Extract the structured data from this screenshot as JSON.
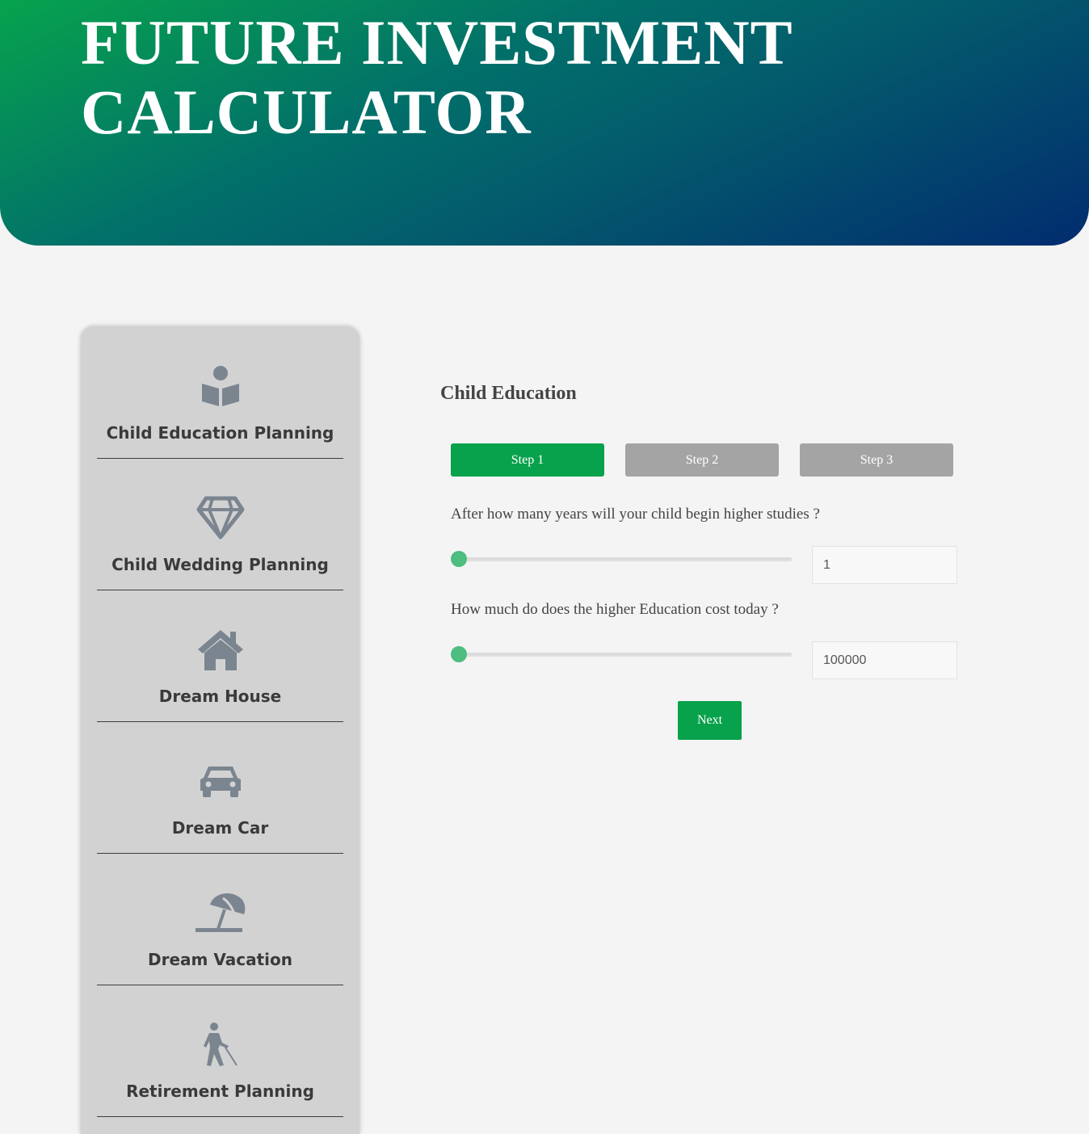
{
  "header": {
    "title_line1": "FUTURE INVESTMENT",
    "title_line2": "CALCULATOR"
  },
  "sidebar": {
    "items": [
      {
        "label": "Child Education Planning",
        "icon": "book-reader-icon"
      },
      {
        "label": "Child Wedding Planning",
        "icon": "diamond-icon"
      },
      {
        "label": "Dream House",
        "icon": "house-icon"
      },
      {
        "label": "Dream Car",
        "icon": "car-icon"
      },
      {
        "label": "Dream Vacation",
        "icon": "beach-umbrella-icon"
      },
      {
        "label": "Retirement Planning",
        "icon": "elderly-person-icon"
      }
    ]
  },
  "main": {
    "section_title": "Child Education",
    "steps": [
      {
        "label": "Step 1",
        "active": true
      },
      {
        "label": "Step 2",
        "active": false
      },
      {
        "label": "Step 3",
        "active": false
      }
    ],
    "questions": [
      {
        "label": "After how many years will your child begin higher studies ?",
        "value": "1",
        "slider_level": 0
      },
      {
        "label": "How much do does the higher Education cost today ?",
        "value": "100000",
        "slider_level": 0
      }
    ],
    "next_label": "Next"
  },
  "colors": {
    "accent_green": "#08a24c",
    "step_inactive": "#a4a4a4",
    "slider_thumb": "#4dbd80",
    "gradient_start": "#07a34d",
    "gradient_end": "#022c6f",
    "sidebar_bg": "#d2d2d2",
    "icon_gray": "#7b8590"
  }
}
